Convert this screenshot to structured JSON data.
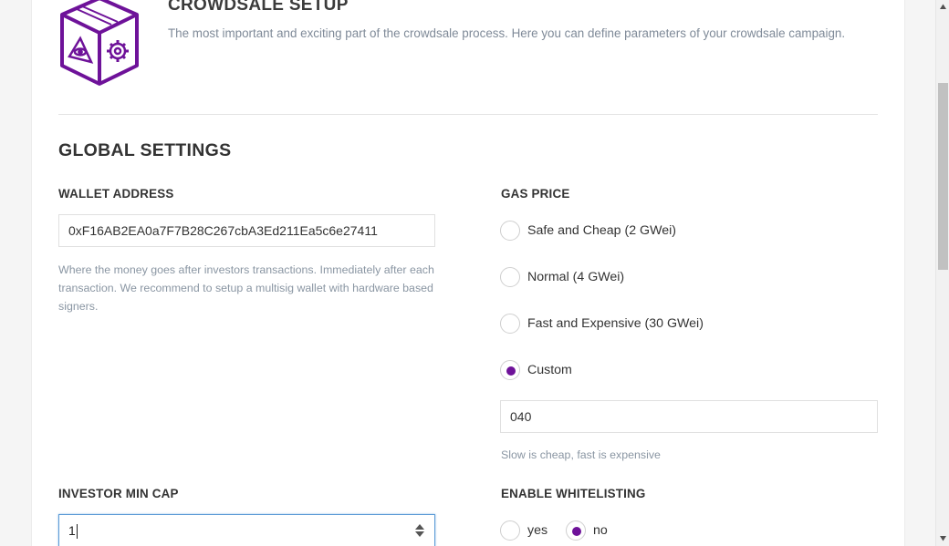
{
  "header": {
    "title": "CROWDSALE SETUP",
    "subtitle": "The most important and exciting part of the crowdsale process. Here you can define parameters of your crowdsale campaign."
  },
  "colors": {
    "accent": "#6e1299",
    "hint": "#8a96a3"
  },
  "global_settings": {
    "title": "GLOBAL SETTINGS",
    "wallet_address": {
      "label": "WALLET ADDRESS",
      "value": "0xF16AB2EA0a7F7B28C267cbA3Ed211Ea5c6e27411",
      "hint": "Where the money goes after investors transactions. Immediately after each transaction. We recommend to setup a multisig wallet with hardware based signers."
    },
    "gas_price": {
      "label": "GAS PRICE",
      "options": [
        {
          "label": "Safe and Cheap (2 GWei)",
          "checked": false
        },
        {
          "label": "Normal (4 GWei)",
          "checked": false
        },
        {
          "label": "Fast and Expensive (30 GWei)",
          "checked": false
        },
        {
          "label": "Custom",
          "checked": true
        }
      ],
      "custom_value": "040",
      "hint": "Slow is cheap, fast is expensive"
    },
    "investor_min_cap": {
      "label": "INVESTOR MIN CAP",
      "value": "1"
    },
    "whitelisting": {
      "label": "ENABLE WHITELISTING",
      "options": [
        {
          "label": "yes",
          "checked": false
        },
        {
          "label": "no",
          "checked": true
        }
      ]
    }
  },
  "icons": {
    "logo": "crowdsale-box-logo-icon",
    "spinner": "number-spinner-icon"
  }
}
